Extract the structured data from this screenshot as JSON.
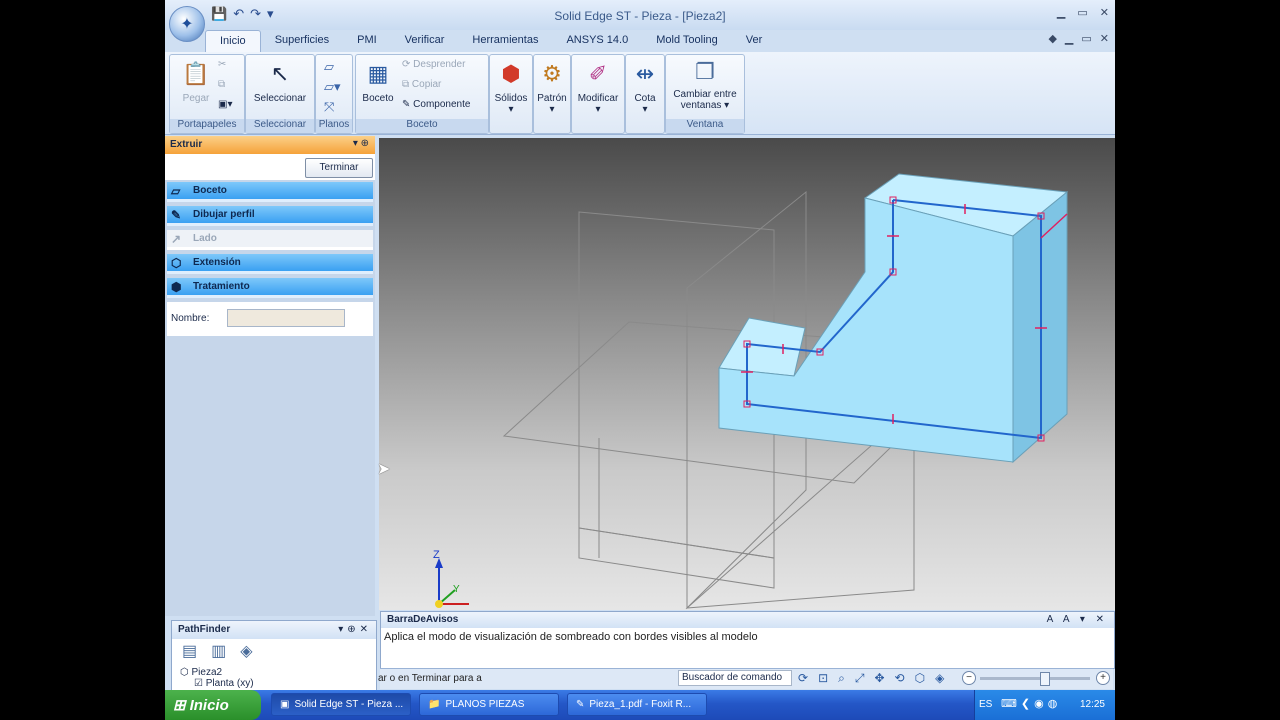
{
  "window": {
    "title": "Solid Edge ST - Pieza - [Pieza2]",
    "min": "▁",
    "max": "▭",
    "close": "✕"
  },
  "qat": {
    "save": "💾",
    "undo": "↶",
    "redo": "↷",
    "more": "▾"
  },
  "tabs": [
    "Inicio",
    "Superficies",
    "PMI",
    "Verificar",
    "Herramientas",
    "ANSYS 14.0",
    "Mold Tooling",
    "Ver"
  ],
  "ribbon": {
    "portapapeles": {
      "label": "Portapapeles",
      "pegar": "Pegar"
    },
    "seleccionar": {
      "label": "Seleccionar",
      "btn": "Seleccionar"
    },
    "planos": {
      "label": "Planos"
    },
    "boceto": {
      "label": "Boceto",
      "btn": "Boceto",
      "desprender": "Desprender",
      "copiar": "Copiar",
      "componente": "Componente"
    },
    "solidos": "Sólidos",
    "patron": "Patrón",
    "modificar": "Modificar",
    "cota": "Cota",
    "ventana": {
      "label": "Ventana",
      "btn1": "Cambiar entre",
      "btn2": "ventanas"
    }
  },
  "extrude_panel": {
    "title": "Extruir",
    "finish": "Terminar",
    "steps": [
      "Boceto",
      "Dibujar perfil",
      "Lado",
      "Extensión",
      "Tratamiento"
    ],
    "name_label": "Nombre:",
    "name_value": ""
  },
  "pathfinder": {
    "title": "PathFinder",
    "item1": "Pieza2",
    "item2": "Planta (xy)"
  },
  "notice": {
    "title": "BarraDeAvisos",
    "text": "Aplica el modo de visualización de sombreado con bordes visibles al modelo",
    "ctl": "A A ▾ ✕"
  },
  "status": {
    "prompt": "ar o en Terminar para a",
    "command_finder": "Buscador de comando"
  },
  "axes": {
    "z": "Z",
    "y": "Y"
  },
  "taskbar": {
    "start": "Inicio",
    "items": [
      "Solid Edge ST - Pieza ...",
      "PLANOS PIEZAS",
      "Pieza_1.pdf - Foxit R..."
    ],
    "lang": "ES",
    "clock": "12:25"
  },
  "colors": {
    "accent": "#f5a23a",
    "part": "#a7e3fb",
    "step": "#3aa0f2",
    "taskbar": "#2457c7"
  }
}
